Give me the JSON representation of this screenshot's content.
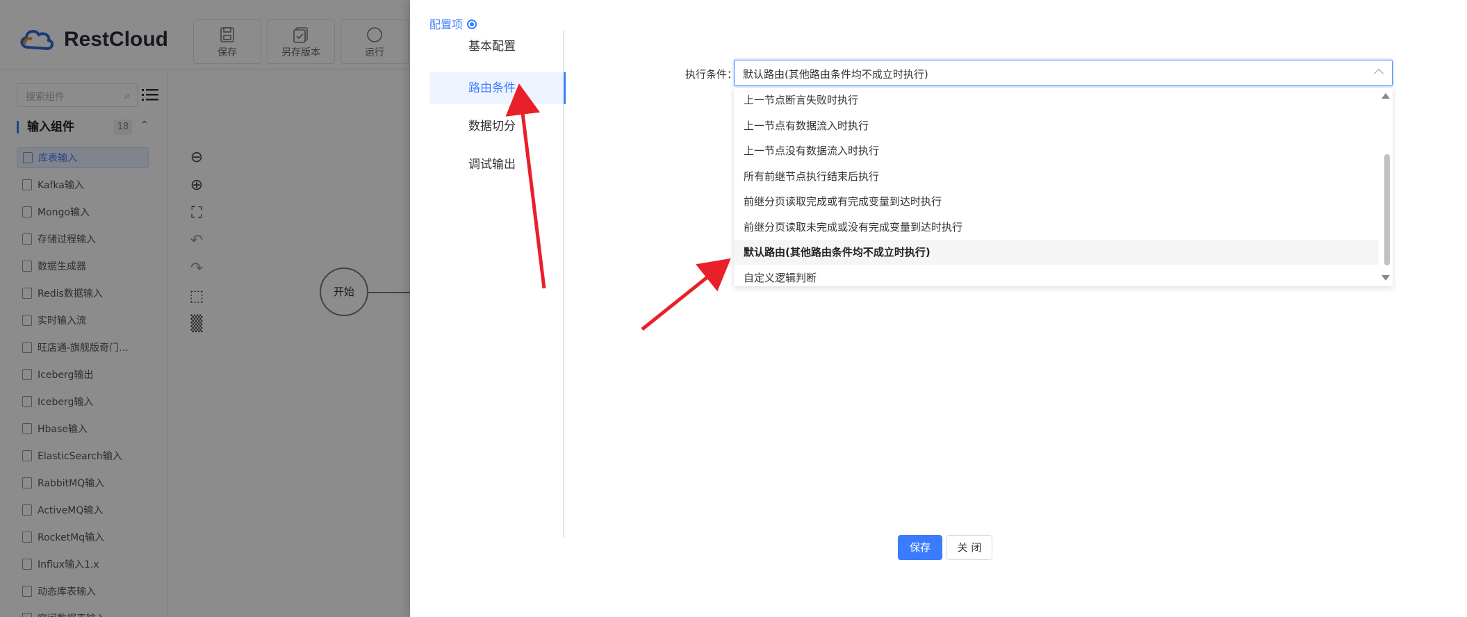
{
  "app": {
    "name": "RestCloud"
  },
  "toolbar": {
    "buttons": [
      {
        "label": "保存",
        "icon": "save-icon"
      },
      {
        "label": "另存版本",
        "icon": "save-version-icon"
      },
      {
        "label": "运行",
        "icon": "run-icon"
      }
    ]
  },
  "sidebar": {
    "search_placeholder": "搜索组件",
    "section_title": "输入组件",
    "section_count": "18",
    "items": [
      {
        "label": "库表输入",
        "active": true
      },
      {
        "label": "Kafka输入"
      },
      {
        "label": "Mongo输入"
      },
      {
        "label": "存储过程输入"
      },
      {
        "label": "数据生成器"
      },
      {
        "label": "Redis数据输入"
      },
      {
        "label": "实时输入流"
      },
      {
        "label": "旺店通-旗舰版奇门…"
      },
      {
        "label": "Iceberg输出"
      },
      {
        "label": "Iceberg输入"
      },
      {
        "label": "Hbase输入"
      },
      {
        "label": "ElasticSearch输入"
      },
      {
        "label": "RabbitMQ输入"
      },
      {
        "label": "ActiveMQ输入"
      },
      {
        "label": "RocketMq输入"
      },
      {
        "label": "Influx输入1.x"
      },
      {
        "label": "动态库表输入"
      },
      {
        "label": "空间数据表输入"
      }
    ]
  },
  "canvas": {
    "start_node_label": "开始"
  },
  "drawer": {
    "title": "配置项",
    "tabs": [
      {
        "label": "基本配置"
      },
      {
        "label": "路由条件",
        "active": true
      },
      {
        "label": "数据切分"
      },
      {
        "label": "调试输出"
      }
    ],
    "form": {
      "condition_label": "执行条件：",
      "condition_value": "默认路由(其他路由条件均不成立时执行)"
    },
    "dropdown_options": [
      {
        "label": "上一节点断言失败时执行"
      },
      {
        "label": "上一节点有数据流入时执行"
      },
      {
        "label": "上一节点没有数据流入时执行"
      },
      {
        "label": "所有前继节点执行结束后执行"
      },
      {
        "label": "前继分页读取完成或有完成变量到达时执行"
      },
      {
        "label": "前继分页读取未完成或没有完成变量到达时执行"
      },
      {
        "label": "默认路由(其他路由条件均不成立时执行)",
        "selected": true
      },
      {
        "label": "自定义逻辑判断"
      }
    ],
    "save_label": "保存",
    "close_label": "关 闭"
  },
  "colors": {
    "accent": "#3b7cff",
    "annotation_arrow": "#e8202a"
  }
}
